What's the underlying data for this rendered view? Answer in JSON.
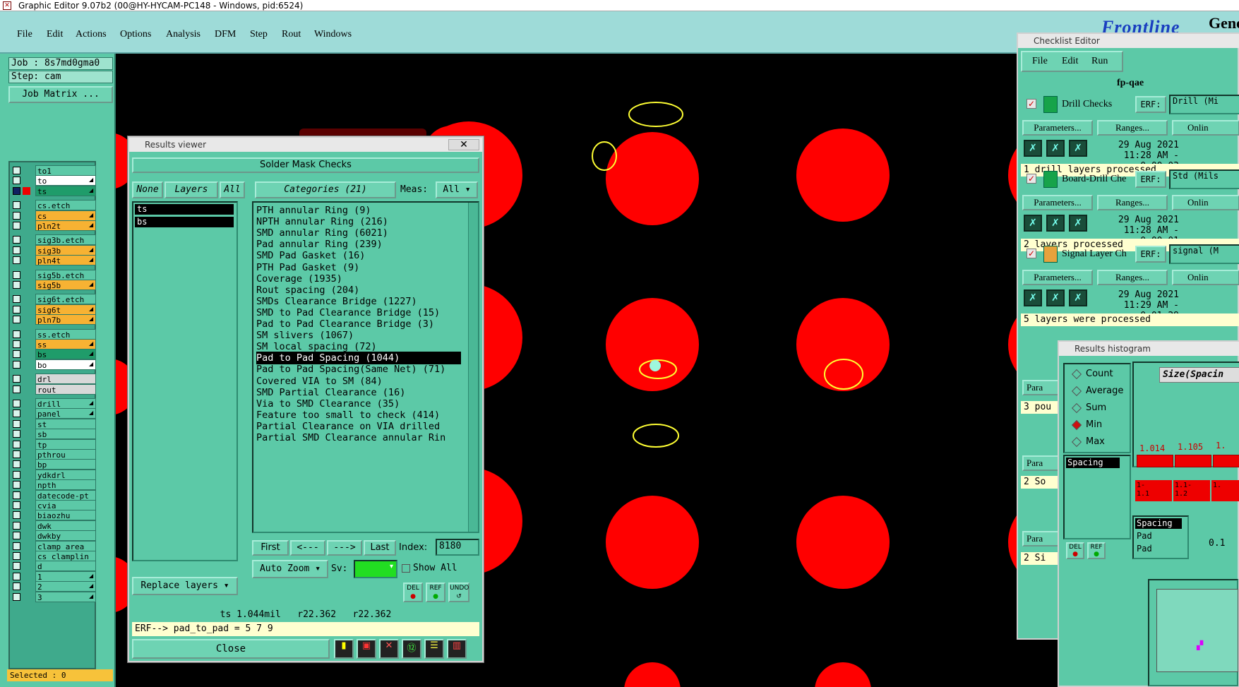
{
  "window_title": "Graphic Editor 9.07b2 (00@HY-HYCAM-PC148 - Windows, pid:6524)",
  "menu": [
    "File",
    "Edit",
    "Actions",
    "Options",
    "Analysis",
    "DFM",
    "Step",
    "Rout",
    "Windows"
  ],
  "brand": {
    "left": "Frontline",
    "right": "Genesi"
  },
  "job": {
    "job_label": "Job : 8s7md0gma0",
    "step_label": "Step: cam",
    "matrix_button": "Job Matrix ..."
  },
  "layers": [
    {
      "name": "to1",
      "color": "teal",
      "arrow": false
    },
    {
      "name": "to",
      "color": "white",
      "arrow": true
    },
    {
      "name": "ts",
      "color": "green",
      "arrow": true,
      "checked": true,
      "red": true
    },
    {
      "name": "cs.etch",
      "color": "teal",
      "arrow": false
    },
    {
      "name": "cs",
      "color": "orange",
      "arrow": true
    },
    {
      "name": "pln2t",
      "color": "orange",
      "arrow": true
    },
    {
      "name": "sig3b.etch",
      "color": "teal",
      "arrow": false
    },
    {
      "name": "sig3b",
      "color": "orange",
      "arrow": true
    },
    {
      "name": "pln4t",
      "color": "orange",
      "arrow": true
    },
    {
      "name": "sig5b.etch",
      "color": "teal",
      "arrow": false
    },
    {
      "name": "sig5b",
      "color": "orange",
      "arrow": true
    },
    {
      "name": "sig6t.etch",
      "color": "teal",
      "arrow": false
    },
    {
      "name": "sig6t",
      "color": "orange",
      "arrow": true
    },
    {
      "name": "pln7b",
      "color": "orange",
      "arrow": true
    },
    {
      "name": "ss.etch",
      "color": "teal",
      "arrow": false
    },
    {
      "name": "ss",
      "color": "orange",
      "arrow": true
    },
    {
      "name": "bs",
      "color": "green",
      "arrow": true
    },
    {
      "name": "bo",
      "color": "white",
      "arrow": true
    },
    {
      "name": "drl",
      "color": "grey",
      "arrow": false
    },
    {
      "name": "rout",
      "color": "grey",
      "arrow": false
    },
    {
      "name": "drill",
      "color": "teal",
      "arrow": true
    },
    {
      "name": "panel",
      "color": "teal",
      "arrow": true
    },
    {
      "name": "st",
      "color": "teal",
      "arrow": false
    },
    {
      "name": "sb",
      "color": "teal",
      "arrow": false
    },
    {
      "name": "tp",
      "color": "teal",
      "arrow": false
    },
    {
      "name": "pthrou",
      "color": "teal",
      "arrow": false
    },
    {
      "name": "bp",
      "color": "teal",
      "arrow": false
    },
    {
      "name": "ydkdrl",
      "color": "teal",
      "arrow": false
    },
    {
      "name": "npth",
      "color": "teal",
      "arrow": false
    },
    {
      "name": "datecode-pt",
      "color": "teal",
      "arrow": false
    },
    {
      "name": "cvia",
      "color": "teal",
      "arrow": false
    },
    {
      "name": "biaozhu",
      "color": "teal",
      "arrow": false
    },
    {
      "name": "dwk",
      "color": "teal",
      "arrow": false
    },
    {
      "name": "dwkby",
      "color": "teal",
      "arrow": false
    },
    {
      "name": "clamp_area",
      "color": "teal",
      "arrow": false
    },
    {
      "name": "cs_clamplin",
      "color": "teal",
      "arrow": false
    },
    {
      "name": "d",
      "color": "teal",
      "arrow": false
    },
    {
      "name": "1",
      "color": "teal",
      "arrow": true
    },
    {
      "name": "2",
      "color": "teal",
      "arrow": true
    },
    {
      "name": "3",
      "color": "teal",
      "arrow": true
    }
  ],
  "selected_label": "Selected : 0",
  "results_viewer": {
    "title": "Results viewer",
    "close_x": "✕",
    "header": "Solder Mask Checks",
    "none_btn": "None",
    "layers_btn": "Layers",
    "all_btn": "All",
    "categories_btn": "Categories (21)",
    "meas_label": "Meas:",
    "meas_value": "All",
    "layer_items": [
      "ts",
      "bs"
    ],
    "categories": [
      "PTH annular Ring (9)",
      "NPTH annular Ring (216)",
      "SMD annular Ring (6021)",
      "Pad annular Ring (239)",
      "SMD Pad Gasket (16)",
      "PTH Pad Gasket (9)",
      "Coverage (1935)",
      "Rout spacing (204)",
      "SMDs Clearance Bridge (1227)",
      "SMD to Pad Clearance Bridge (15)",
      "Pad to Pad Clearance Bridge (3)",
      "SM slivers (1067)",
      "SM local spacing (72)",
      "Pad to Pad Spacing (1044)",
      "Pad to Pad Spacing(Same Net) (71)",
      "Covered VIA to SM (84)",
      "SMD Partial Clearance (16)",
      "Via to SMD Clearance (35)",
      "Feature too small to check (414)",
      "Partial Clearance on VIA drilled",
      "Partial SMD Clearance annular Rin"
    ],
    "selected_category_index": 13,
    "first_btn": "First",
    "prev_btn": "<---",
    "next_btn": "--->",
    "last_btn": "Last",
    "index_label": "Index:",
    "index_value": "8180",
    "autozoom_btn": "Auto Zoom",
    "sv_label": "Sv:",
    "show_all_label": "Show All",
    "replace_layers_btn": "Replace layers",
    "del_btn": "DEL",
    "ref_btn": "REF",
    "undo_btn": "UNDO",
    "measure_line": "ts 1.044mil   r22.362   r22.362",
    "erf_line": "ERF--> pad_to_pad = 5 7 9",
    "close_btn": "Close"
  },
  "checklist_editor": {
    "title": "Checklist Editor",
    "menu": [
      "File",
      "Edit",
      "Run"
    ],
    "checklist_name": "fp-qae",
    "checks": [
      {
        "name": "Drill Checks",
        "erf_label": "ERF:",
        "erf_value": "Drill (Mi",
        "params": "Parameters...",
        "ranges": "Ranges...",
        "online": "Onlin",
        "date": "29 Aug 2021",
        "time": "11:28 AM - 0:00:03",
        "status": "1 drill layers processed"
      },
      {
        "name": "Board-Drill Che",
        "erf_label": "ERF:",
        "erf_value": "Std (Mils",
        "params": "Parameters...",
        "ranges": "Ranges...",
        "online": "Onlin",
        "date": "29 Aug 2021",
        "time": "11:28 AM - 0:00:01",
        "status": "2 layers processed"
      },
      {
        "name": "Signal Layer Ch",
        "erf_label": "ERF:",
        "erf_value": "signal (M",
        "params": "Parameters...",
        "ranges": "Ranges...",
        "online": "Onlin",
        "date": "29 Aug 2021",
        "time": "11:29 AM - 0:01:29",
        "status": "5 layers were processed"
      }
    ],
    "partial_rows": [
      "Para",
      "3 pou",
      "Para",
      "2 So",
      "Para",
      "2 Si"
    ]
  },
  "histogram": {
    "title": "Results histogram",
    "options": [
      "Count",
      "Average",
      "Sum",
      "Min",
      "Max"
    ],
    "selected_option": "Min",
    "size_label": "Size(Spacin",
    "list_item": "Spacing",
    "bar_labels": [
      "1.014",
      "1.105",
      "1."
    ],
    "range_labels": [
      "1-\n1.1",
      "1.1-\n1.2",
      "1."
    ],
    "bottom_list": [
      "Spacing",
      "Pad",
      "Pad"
    ],
    "bottom_value": "0.1",
    "del_btn": "DEL",
    "ref_btn": "REF"
  },
  "colors": {
    "pad_red": "#ff0000",
    "panel_teal": "#5cc9a7",
    "menu_bg": "#9edbd8",
    "marker_yellow": "#ffff33"
  }
}
